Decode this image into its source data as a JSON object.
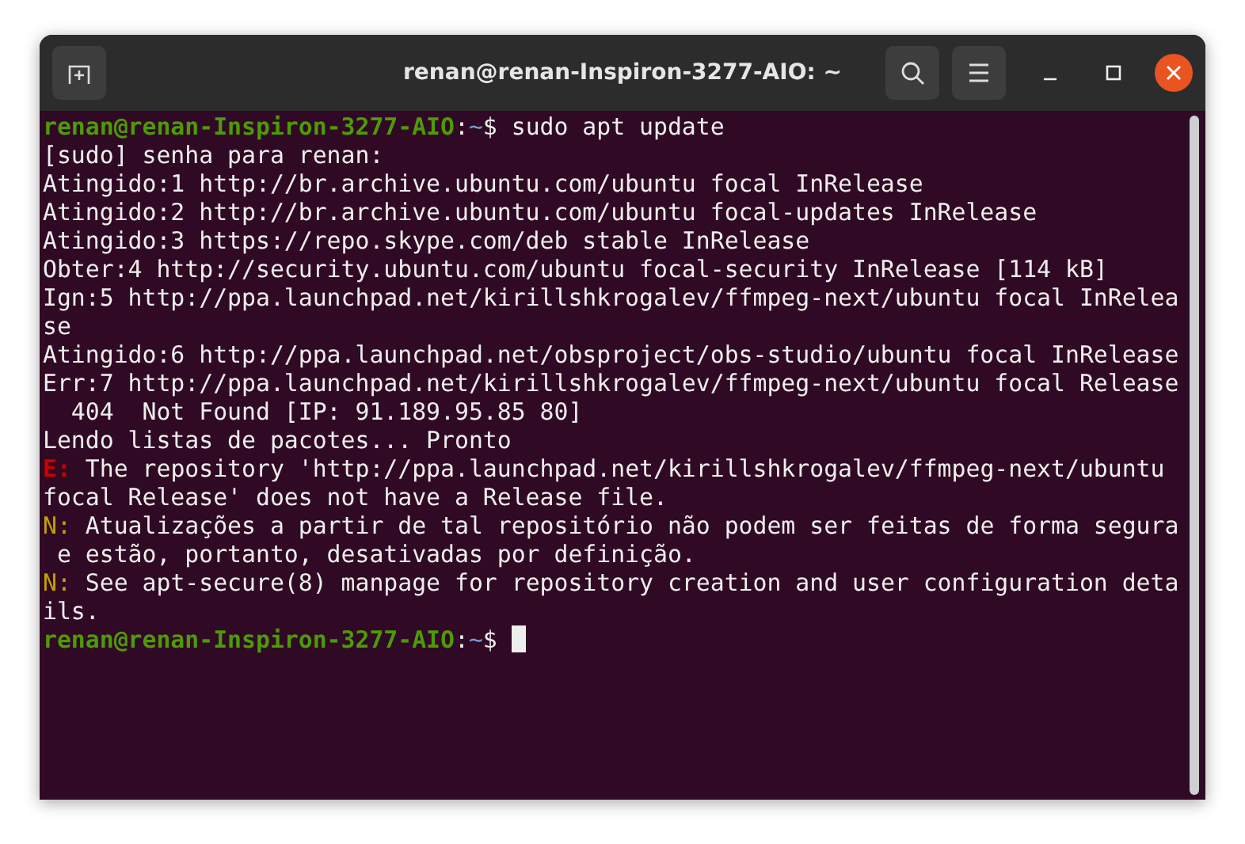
{
  "window": {
    "title": "renan@renan-Inspiron-3277-AIO: ~"
  },
  "terminal": {
    "cursor": true,
    "lines": [
      {
        "segments": [
          {
            "kind": "user",
            "text": "renan@renan-Inspiron-3277-AIO"
          },
          {
            "kind": "plain",
            "text": ":"
          },
          {
            "kind": "path",
            "text": "~"
          },
          {
            "kind": "plain",
            "text": "$ sudo apt update"
          }
        ]
      },
      {
        "segments": [
          {
            "kind": "plain",
            "text": "[sudo] senha para renan:"
          }
        ]
      },
      {
        "segments": [
          {
            "kind": "plain",
            "text": "Atingido:1 http://br.archive.ubuntu.com/ubuntu focal InRelease"
          }
        ]
      },
      {
        "segments": [
          {
            "kind": "plain",
            "text": "Atingido:2 http://br.archive.ubuntu.com/ubuntu focal-updates InRelease"
          }
        ]
      },
      {
        "segments": [
          {
            "kind": "plain",
            "text": "Atingido:3 https://repo.skype.com/deb stable InRelease"
          }
        ]
      },
      {
        "segments": [
          {
            "kind": "plain",
            "text": "Obter:4 http://security.ubuntu.com/ubuntu focal-security InRelease [114 kB]"
          }
        ]
      },
      {
        "segments": [
          {
            "kind": "plain",
            "text": "Ign:5 http://ppa.launchpad.net/kirillshkrogalev/ffmpeg-next/ubuntu focal InRelea"
          }
        ]
      },
      {
        "segments": [
          {
            "kind": "plain",
            "text": "se"
          }
        ]
      },
      {
        "segments": [
          {
            "kind": "plain",
            "text": "Atingido:6 http://ppa.launchpad.net/obsproject/obs-studio/ubuntu focal InRelease"
          }
        ]
      },
      {
        "segments": [
          {
            "kind": "plain",
            "text": "Err:7 http://ppa.launchpad.net/kirillshkrogalev/ffmpeg-next/ubuntu focal Release"
          }
        ]
      },
      {
        "segments": [
          {
            "kind": "plain",
            "text": "  404  Not Found [IP: 91.189.95.85 80]"
          }
        ]
      },
      {
        "segments": [
          {
            "kind": "plain",
            "text": "Lendo listas de pacotes... Pronto"
          }
        ]
      },
      {
        "segments": [
          {
            "kind": "error",
            "text": "E:"
          },
          {
            "kind": "plain",
            "text": " The repository 'http://ppa.launchpad.net/kirillshkrogalev/ffmpeg-next/ubuntu"
          }
        ]
      },
      {
        "segments": [
          {
            "kind": "plain",
            "text": "focal Release' does not have a Release file."
          }
        ]
      },
      {
        "segments": [
          {
            "kind": "note",
            "text": "N:"
          },
          {
            "kind": "plain",
            "text": " Atualizações a partir de tal repositório não podem ser feitas de forma segura"
          }
        ]
      },
      {
        "segments": [
          {
            "kind": "plain",
            "text": " e estão, portanto, desativadas por definição."
          }
        ]
      },
      {
        "segments": [
          {
            "kind": "note",
            "text": "N:"
          },
          {
            "kind": "plain",
            "text": " See apt-secure(8) manpage for repository creation and user configuration deta"
          }
        ]
      },
      {
        "segments": [
          {
            "kind": "plain",
            "text": "ils."
          }
        ]
      },
      {
        "segments": [
          {
            "kind": "user",
            "text": "renan@renan-Inspiron-3277-AIO"
          },
          {
            "kind": "plain",
            "text": ":"
          },
          {
            "kind": "path",
            "text": "~"
          },
          {
            "kind": "plain",
            "text": "$ "
          }
        ]
      }
    ]
  }
}
